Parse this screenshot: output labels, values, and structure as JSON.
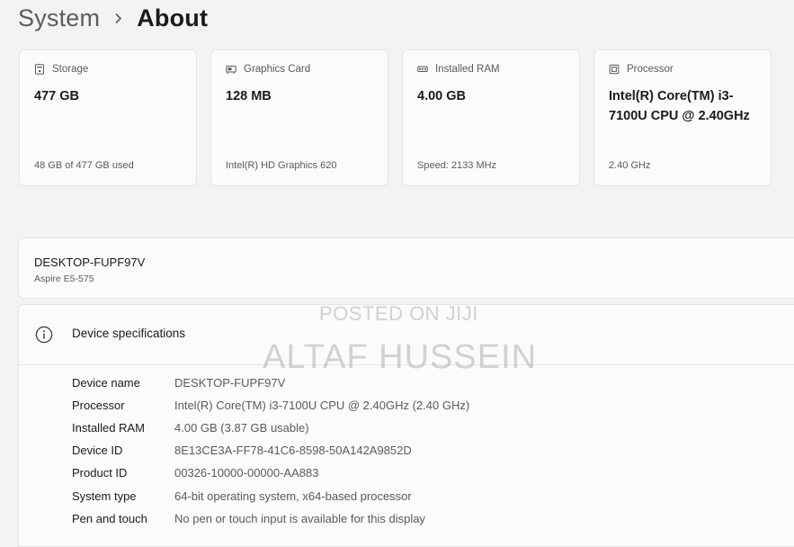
{
  "breadcrumb": {
    "parent": "System",
    "current": "About"
  },
  "cards": [
    {
      "icon": "storage-icon",
      "title": "Storage",
      "value": "477 GB",
      "sub": "48 GB of 477 GB used"
    },
    {
      "icon": "graphics-card-icon",
      "title": "Graphics Card",
      "value": "128 MB",
      "sub": "Intel(R) HD Graphics 620"
    },
    {
      "icon": "ram-icon",
      "title": "Installed RAM",
      "value": "4.00 GB",
      "sub": "Speed: 2133 MHz"
    },
    {
      "icon": "processor-icon",
      "title": "Processor",
      "value": "Intel(R) Core(TM) i3-7100U CPU @ 2.40GHz",
      "sub": "2.40 GHz"
    }
  ],
  "device": {
    "name": "DESKTOP-FUPF97V",
    "model": "Aspire E5-575"
  },
  "specs": {
    "title": "Device specifications",
    "rows": [
      {
        "label": "Device name",
        "value": "DESKTOP-FUPF97V"
      },
      {
        "label": "Processor",
        "value": "Intel(R) Core(TM) i3-7100U CPU @ 2.40GHz (2.40 GHz)"
      },
      {
        "label": "Installed RAM",
        "value": "4.00 GB (3.87 GB usable)"
      },
      {
        "label": "Device ID",
        "value": "8E13CE3A-FF78-41C6-8598-50A142A9852D"
      },
      {
        "label": "Product ID",
        "value": "00326-10000-00000-AA883"
      },
      {
        "label": "System type",
        "value": "64-bit operating system, x64-based processor"
      },
      {
        "label": "Pen and touch",
        "value": "No pen or touch input is available for this display"
      }
    ]
  },
  "watermark": {
    "line1": "POSTED ON JIJI",
    "line2": "ALTAF HUSSEIN"
  },
  "colors": {
    "background": "#f3f3f3",
    "card": "#fbfbfb",
    "border": "#e4e4e4"
  }
}
